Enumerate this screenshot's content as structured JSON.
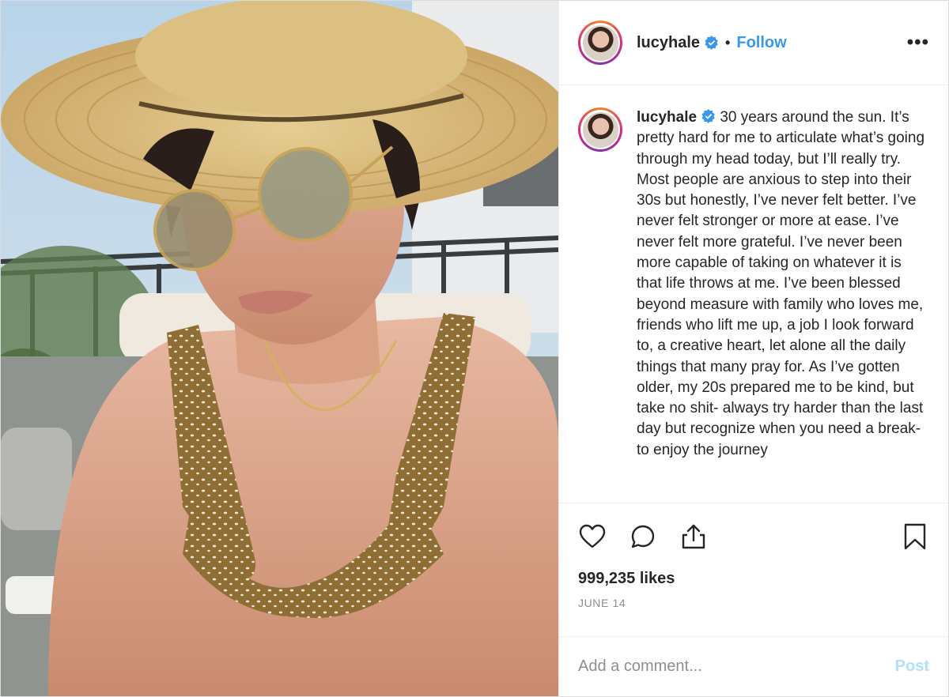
{
  "post": {
    "username": "lucyhale",
    "follow_label": "Follow",
    "separator": "•",
    "more_label": "•••",
    "caption": "30 years around the sun. It’s pretty hard for me to articulate what’s going through my head today, but I’ll really try. Most people are anxious to step into their 30s but honestly, I’ve never felt better. I’ve never felt stronger or more at ease. I’ve never felt more grateful. I’ve never been more capable of taking on whatever it is that life throws at me. I’ve been blessed beyond measure with family who loves me, friends who lift me up, a job I look forward to, a creative heart, let alone all the daily things that many pray for. As I’ve gotten older, my 20s prepared me to be kind, but take no shit- always try harder than the last day but recognize when you need a break- to enjoy the journey",
    "likes": "999,235 likes",
    "date": "JUNE 14",
    "comment_placeholder": "Add a comment...",
    "post_label": "Post"
  },
  "icons": {
    "verified": "verified-badge-icon",
    "like": "heart-icon",
    "comment": "comment-icon",
    "share": "share-icon",
    "save": "bookmark-icon"
  },
  "colors": {
    "accent": "#3897f0",
    "post_disabled": "#b2dffc",
    "muted": "#8e8e8e"
  }
}
